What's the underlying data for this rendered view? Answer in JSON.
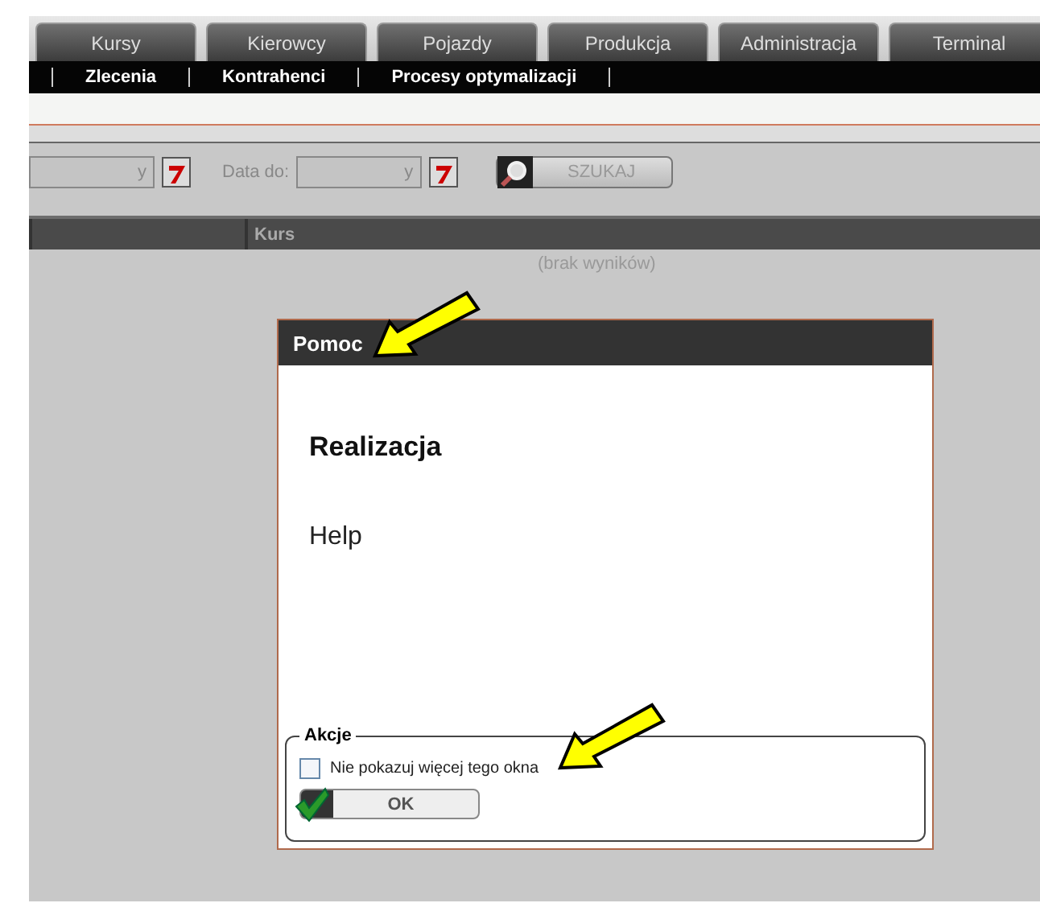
{
  "tabs": [
    {
      "label": "Kursy",
      "selected": false
    },
    {
      "label": "Kierowcy",
      "selected": false
    },
    {
      "label": "Pojazdy",
      "selected": false
    },
    {
      "label": "Produkcja",
      "selected": false
    },
    {
      "label": "Administracja",
      "selected": false
    },
    {
      "label": "Terminal",
      "selected": false
    }
  ],
  "submenu": [
    "Zlecenia",
    "Kontrahenci",
    "Procesy optymalizacji"
  ],
  "filters": [
    {
      "value": "y"
    },
    {
      "label": "Data do:",
      "value": "y"
    }
  ],
  "search_button": "SZUKAJ",
  "table": {
    "columns": [
      "",
      "Kurs"
    ],
    "empty_text": "(brak wyników)"
  },
  "dialog": {
    "title": "Pomoc",
    "heading": "Realizacja",
    "body": "Help",
    "actions_legend": "Akcje",
    "checkbox": {
      "label": "Nie pokazuj więcej tego okna",
      "checked": false
    },
    "ok_button": "OK"
  }
}
